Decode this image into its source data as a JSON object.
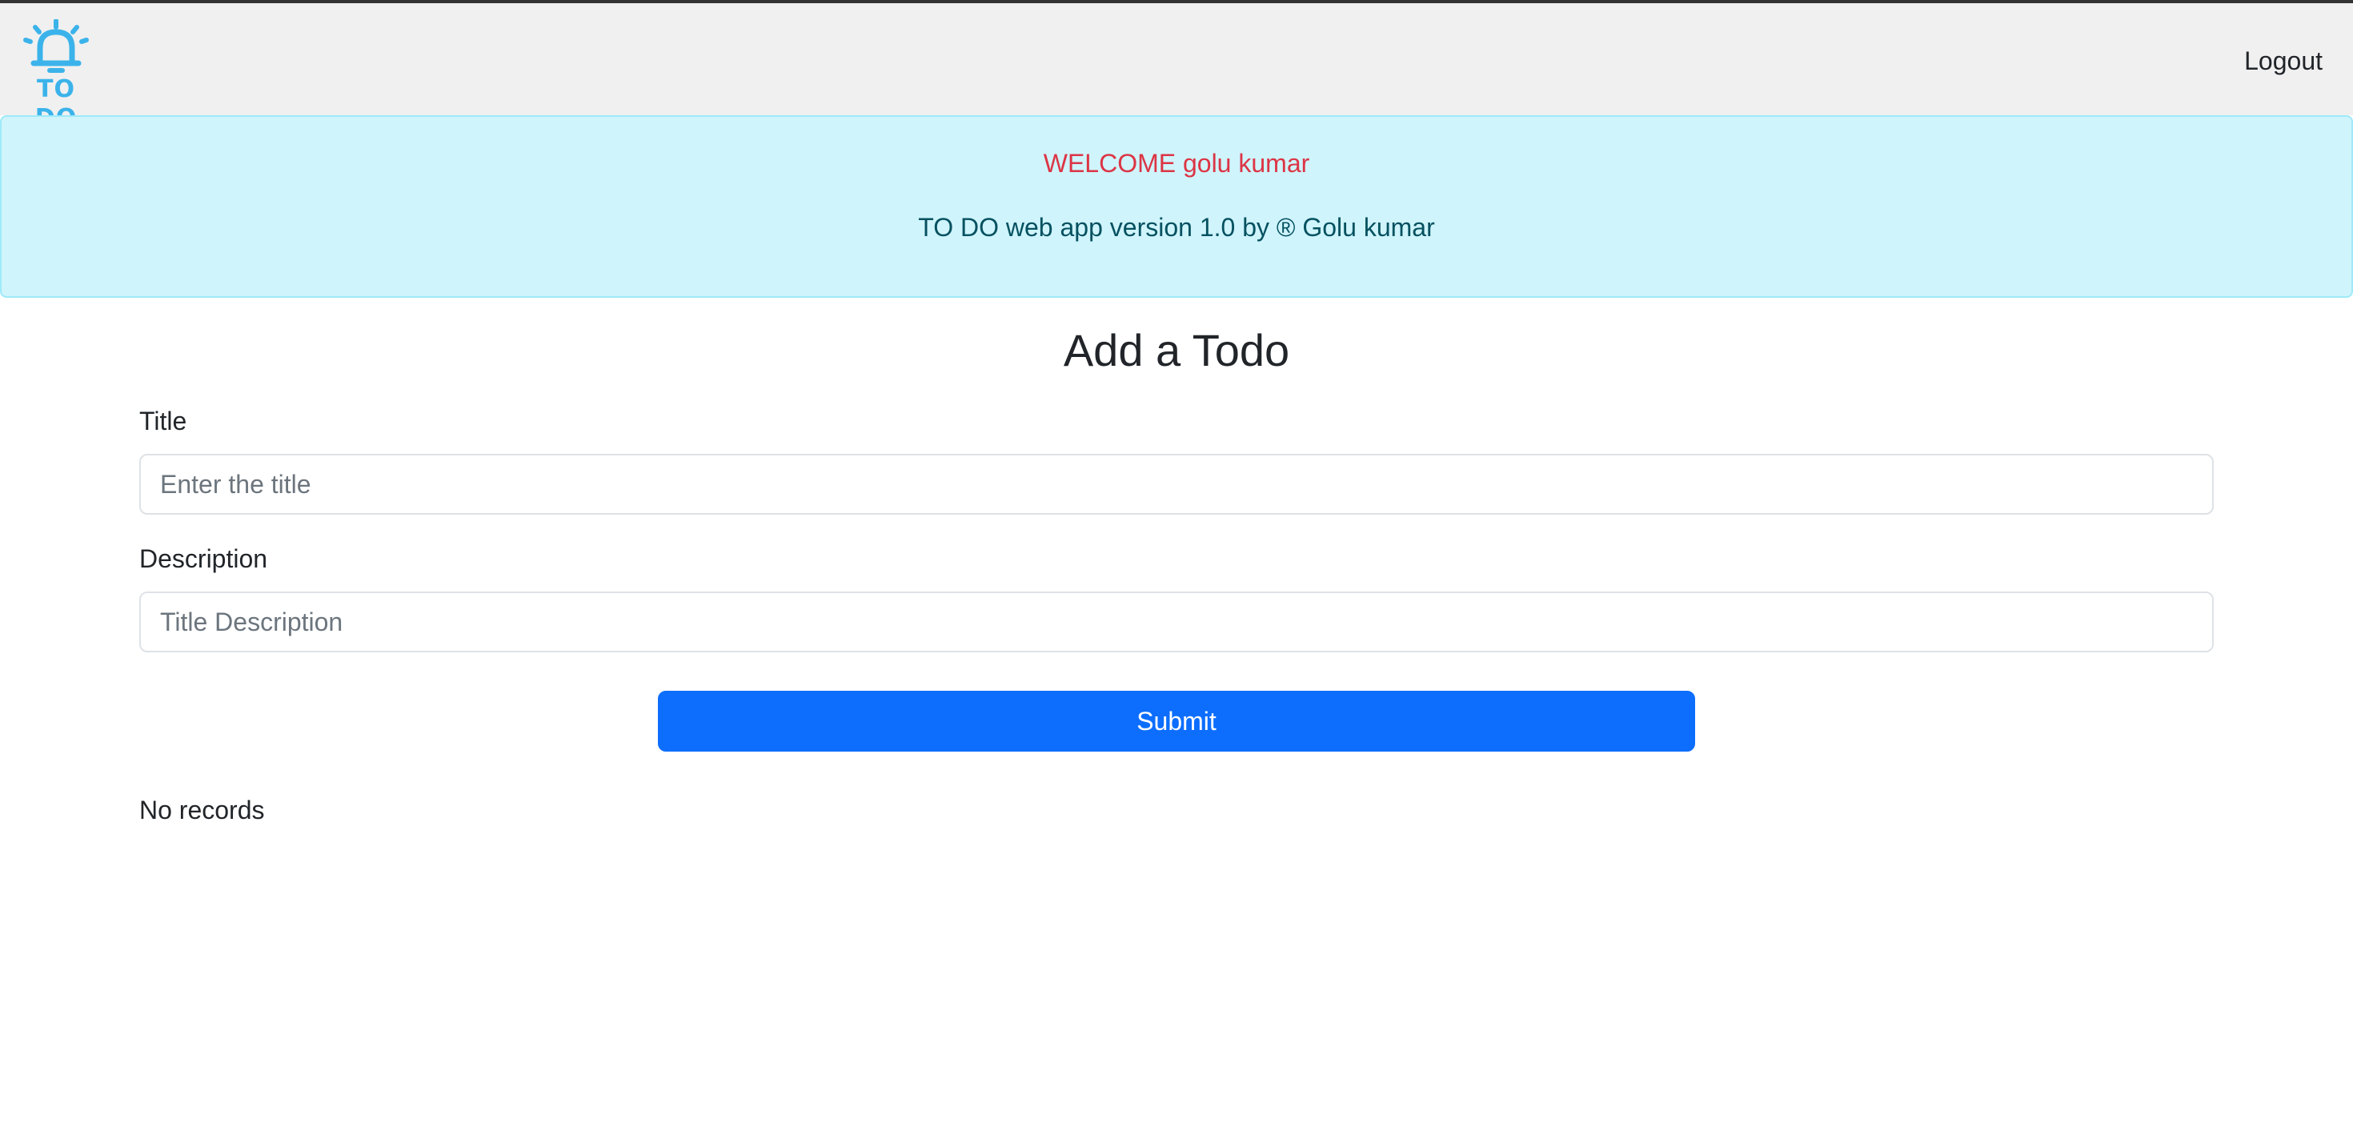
{
  "navbar": {
    "logo_text": "TO DO",
    "logo_icon": "bell-icon",
    "logout_label": "Logout"
  },
  "alert": {
    "welcome": "WELCOME golu kumar",
    "version": "TO DO web app version 1.0 by ® Golu kumar"
  },
  "form": {
    "heading": "Add a Todo",
    "title_label": "Title",
    "title_placeholder": "Enter the title",
    "title_value": "",
    "description_label": "Description",
    "description_placeholder": "Title Description",
    "description_value": "",
    "submit_label": "Submit"
  },
  "todos": {
    "empty_message": "No records",
    "items": []
  },
  "colors": {
    "logo": "#3bb3ea",
    "welcome_text": "#dc3545",
    "alert_background": "#cff4fc",
    "alert_text": "#055160",
    "primary_button": "#0d6efd",
    "navbar_background": "#f0f0f0"
  }
}
